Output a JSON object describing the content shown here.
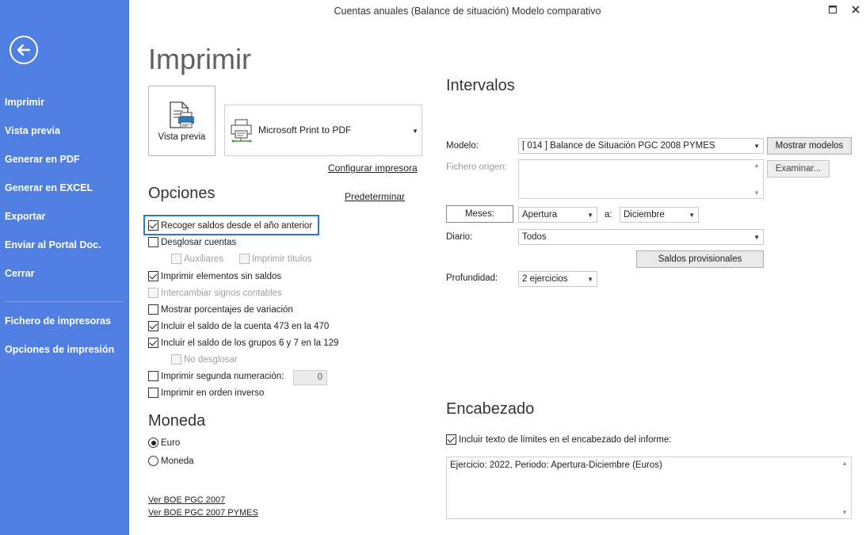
{
  "window": {
    "title": "Cuentas anuales (Balance de situación) Modelo comparativo"
  },
  "sidebar": {
    "items": [
      {
        "label": "Imprimir"
      },
      {
        "label": "Vista previa"
      },
      {
        "label": "Generar en PDF"
      },
      {
        "label": "Generar en EXCEL"
      },
      {
        "label": "Exportar"
      },
      {
        "label": "Enviar al Portal Doc."
      },
      {
        "label": "Cerrar"
      },
      {
        "label": "Fichero de impresoras"
      },
      {
        "label": "Opciones de impresión"
      }
    ]
  },
  "print": {
    "title": "Imprimir",
    "preview_label": "Vista previa",
    "printer_name": "Microsoft Print to PDF",
    "configure_link": "Configurar impresora"
  },
  "options": {
    "title": "Opciones",
    "default_link": "Predeterminar",
    "items": [
      {
        "label": "Recoger saldos desde el año anterior",
        "checked": true,
        "disabled": false
      },
      {
        "label": "Desglosar cuentas",
        "checked": false,
        "disabled": false
      },
      {
        "label": "Auxiliares",
        "checked": false,
        "disabled": true
      },
      {
        "label": "Imprimir títulos",
        "checked": false,
        "disabled": true
      },
      {
        "label": "Imprimir elementos sin saldos",
        "checked": true,
        "disabled": false
      },
      {
        "label": "Intercambiar signos contables",
        "checked": false,
        "disabled": true
      },
      {
        "label": "Mostrar porcentajes de variación",
        "checked": false,
        "disabled": false
      },
      {
        "label": "Incluir el saldo de la cuenta 473 en la 470",
        "checked": true,
        "disabled": false
      },
      {
        "label": "Incluir el saldo de los grupos 6 y 7 en la 129",
        "checked": true,
        "disabled": false
      },
      {
        "label": "No desglosar",
        "checked": false,
        "disabled": true
      },
      {
        "label": "Imprimir segunda numeración:",
        "checked": false,
        "disabled": false
      },
      {
        "label": "Imprimir en orden inverso",
        "checked": false,
        "disabled": false
      }
    ],
    "second_numbering_value": "0"
  },
  "currency": {
    "title": "Moneda",
    "options": [
      {
        "label": "Euro",
        "selected": true
      },
      {
        "label": "Moneda",
        "selected": false
      }
    ]
  },
  "links": {
    "boe_2007": "Ver BOE PGC 2007",
    "boe_2007_pymes": "Ver BOE PGC 2007 PYMES"
  },
  "intervals": {
    "title": "Intervalos",
    "model_label": "Modelo:",
    "model_value": "[ 014 ] Balance de Situación PGC 2008 PYMES",
    "show_models_button": "Mostrar modelos",
    "source_file_label": "Fichero origen:",
    "browse_button": "Examinar...",
    "months_button": "Meses:",
    "from_value": "Apertura",
    "to_label": "a:",
    "to_value": "Diciembre",
    "journal_label": "Diario:",
    "journal_value": "Todos",
    "provisional_button": "Saldos provisionales",
    "depth_label": "Profundidad:",
    "depth_value": "2 ejercicios"
  },
  "header": {
    "title": "Encabezado",
    "include_limits_label": "Incluir texto de límites en el encabezado del informe:",
    "include_limits_checked": true,
    "text": "Ejercicio: 2022, Periodo: Apertura-Diciembre (Euros)"
  },
  "colors": {
    "sidebar_bg": "#4f7fe0",
    "focus_border": "#2c7bc0"
  }
}
